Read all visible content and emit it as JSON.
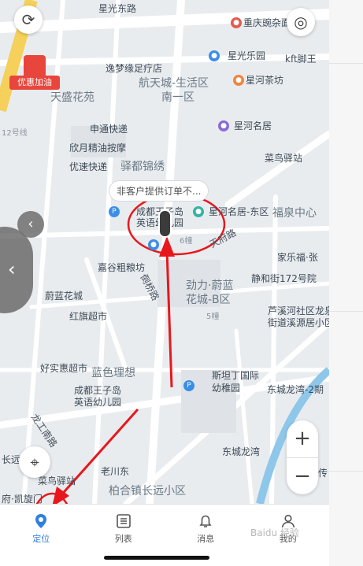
{
  "map": {
    "promo_badge": "优惠加油",
    "tooltip": "非客户提供订单不...",
    "pois": [
      {
        "name": "星光东路"
      },
      {
        "name": "重庆豌杂面"
      },
      {
        "name": "星光乐园"
      },
      {
        "name": "kft脚王"
      },
      {
        "name": "逸梦缘足疗店"
      },
      {
        "name": "航天城-生活区"
      },
      {
        "name": "南一区"
      },
      {
        "name": "星河茶坊"
      },
      {
        "name": "天盛花苑"
      },
      {
        "name": "申通快递"
      },
      {
        "name": "星河名居"
      },
      {
        "name": "欣月精油按摩"
      },
      {
        "name": "菜鸟驿站"
      },
      {
        "name": "优速快递"
      },
      {
        "name": "驿都锦绣"
      },
      {
        "name": "成都王子岛"
      },
      {
        "name": "英语幼儿园"
      },
      {
        "name": "星河名居-东区"
      },
      {
        "name": "福泉中心"
      },
      {
        "name": "天府路"
      },
      {
        "name": "家乐福·张"
      },
      {
        "name": "嘉谷粗粮坊"
      },
      {
        "name": "静和街172号院"
      },
      {
        "name": "劲力·蔚蓝"
      },
      {
        "name": "花城-B区"
      },
      {
        "name": "蔚蓝花城"
      },
      {
        "name": "倒桥路"
      },
      {
        "name": "芦溪河社区龙泉"
      },
      {
        "name": "街道溪源居小区"
      },
      {
        "name": "红旗超市"
      },
      {
        "name": "好实惠超市"
      },
      {
        "name": "蓝色理想"
      },
      {
        "name": "斯坦丁国际"
      },
      {
        "name": "幼稚园"
      },
      {
        "name": "成都王子岛"
      },
      {
        "name": "英语幼儿园"
      },
      {
        "name": "东城龙湾-2期"
      },
      {
        "name": "龙工南路"
      },
      {
        "name": "东城龙湾"
      },
      {
        "name": "老川东"
      },
      {
        "name": "菜鸟驿站"
      },
      {
        "name": "柏合镇长远小区"
      },
      {
        "name": "府·凯旋门"
      },
      {
        "name": "长远"
      },
      {
        "name": "传"
      },
      {
        "name": "12号线"
      },
      {
        "name": "6幢"
      },
      {
        "name": "5幢"
      }
    ]
  },
  "tabs": [
    {
      "label": "定位",
      "icon": "location-pin-icon"
    },
    {
      "label": "列表",
      "icon": "list-icon"
    },
    {
      "label": "消息",
      "icon": "bell-icon"
    },
    {
      "label": "我的",
      "icon": "user-icon"
    }
  ],
  "watermark": "Baidu 经验",
  "colors": {
    "accent": "#2f7fe0",
    "annotation": "#e8171b",
    "map_bg": "#e9ecef"
  }
}
